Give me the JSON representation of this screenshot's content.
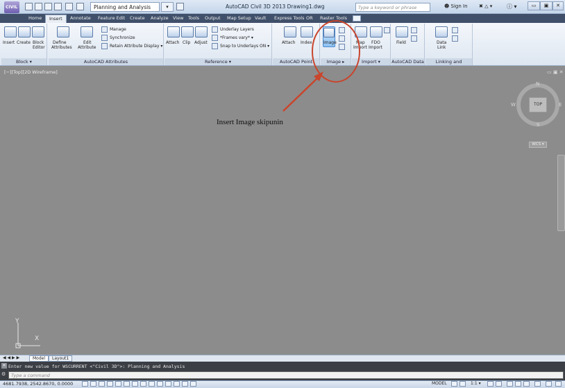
{
  "titlebar": {
    "app_button": "CIVIL",
    "workspace": "Planning and Analysis",
    "title": "AutoCAD Civil 3D 2013   Drawing1.dwg",
    "search_placeholder": "Type a keyword or phrase",
    "sign_in": "Sign In",
    "minimize": "▭",
    "restore": "▣",
    "close": "✕"
  },
  "tabs": [
    "Home",
    "Insert",
    "Annotate",
    "Feature Edit",
    "Create",
    "Analyze",
    "View",
    "Tools",
    "Output",
    "Map Setup",
    "Vault",
    "Express Tools",
    "OR",
    "Raster Tools"
  ],
  "active_tab": "Insert",
  "ribbon": {
    "block": {
      "title": "Block ▾",
      "insert": "Insert",
      "create": "Create",
      "block_editor_1": "Block",
      "block_editor_2": "Editor"
    },
    "attributes": {
      "title": "AutoCAD Attributes",
      "define_1": "Define",
      "define_2": "Attributes",
      "edit_1": "Edit",
      "edit_2": "Attribute",
      "manage": "Manage",
      "synchronize": "Synchronize",
      "retain": "Retain Attribute Display ▾"
    },
    "reference": {
      "title": "Reference ▾",
      "attach": "Attach",
      "clip": "Clip",
      "adjust": "Adjust",
      "underlay_layers": "Underlay Layers",
      "frames": "*Frames vary* ▾",
      "snap": "Snap to Underlays ON ▾"
    },
    "point_cloud": {
      "title": "AutoCAD Point Cloud ▾",
      "attach": "Attach",
      "index": "Index"
    },
    "image": {
      "title": "Image ▸",
      "image": "Image"
    },
    "import": {
      "title": "Import ▾",
      "map_1": "Map",
      "map_2": "Import",
      "fdo_1": "FDO",
      "fdo_2": "Import"
    },
    "data": {
      "title": "AutoCAD Data",
      "field": "Field"
    },
    "linking": {
      "title": "Linking and Extraction",
      "data_link_1": "Data",
      "data_link_2": "Link"
    }
  },
  "viewport": {
    "label": "[−][Top][2D Wireframe]",
    "annotation": "Insert Image skipunin",
    "viewcube": {
      "top": "TOP",
      "n": "N",
      "s": "S",
      "w": "W",
      "e": "E",
      "wcs": "WCS ▾"
    },
    "ucs_x": "X",
    "ucs_y": "Y"
  },
  "layout_tabs": [
    "Model",
    "Layout1"
  ],
  "command": {
    "history": "Enter new value for WSCURRENT <\"Civil 3D\">: Planning and Analysis",
    "prompt": "Type a command"
  },
  "status": {
    "coords": "4681.7938, 2542.8670, 0.0000",
    "model": "MODEL",
    "scale": "1:1 ▾"
  },
  "colors": {
    "annotation_circle": "#c9452c",
    "viewport_bg": "#8c8c8c"
  }
}
